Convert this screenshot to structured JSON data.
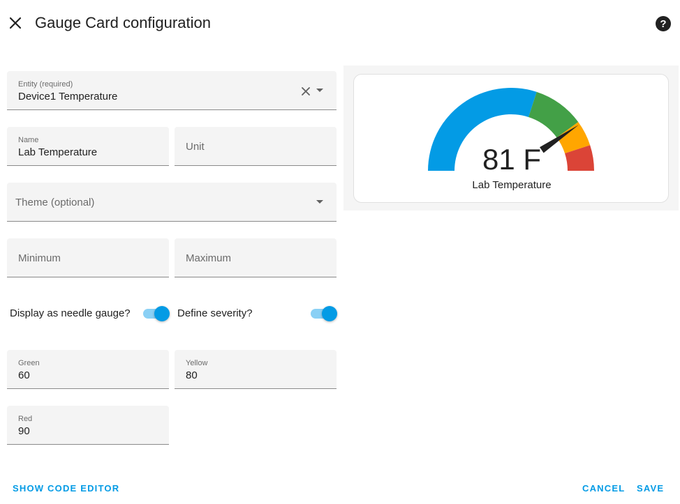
{
  "dialog": {
    "title": "Gauge Card configuration",
    "close_icon": "close-icon",
    "help_icon": "help-circle-icon"
  },
  "form": {
    "entity": {
      "label": "Entity (required)",
      "value": "Device1 Temperature"
    },
    "name": {
      "label": "Name",
      "value": "Lab Temperature"
    },
    "unit": {
      "placeholder": "Unit",
      "value": ""
    },
    "theme": {
      "placeholder": "Theme (optional)",
      "value": ""
    },
    "minimum": {
      "placeholder": "Minimum",
      "value": ""
    },
    "maximum": {
      "placeholder": "Maximum",
      "value": ""
    },
    "needle_toggle": {
      "label": "Display as needle gauge?",
      "checked": true
    },
    "severity_toggle": {
      "label": "Define severity?",
      "checked": true
    },
    "green": {
      "label": "Green",
      "value": "60"
    },
    "yellow": {
      "label": "Yellow",
      "value": "80"
    },
    "red": {
      "label": "Red",
      "value": "90"
    }
  },
  "preview": {
    "value_text": "81 F",
    "name": "Lab Temperature",
    "value": 81,
    "min": 0,
    "max": 100,
    "segments": [
      {
        "from": 0,
        "to": 60,
        "color": "#039be5"
      },
      {
        "from": 60,
        "to": 80,
        "color": "#43a047"
      },
      {
        "from": 80,
        "to": 90,
        "color": "#ffa600"
      },
      {
        "from": 90,
        "to": 100,
        "color": "#db4437"
      }
    ]
  },
  "footer": {
    "code_editor": "Show code editor",
    "cancel": "Cancel",
    "save": "Save"
  },
  "colors": {
    "accent": "#039be5",
    "field_bg": "#f4f4f4"
  }
}
